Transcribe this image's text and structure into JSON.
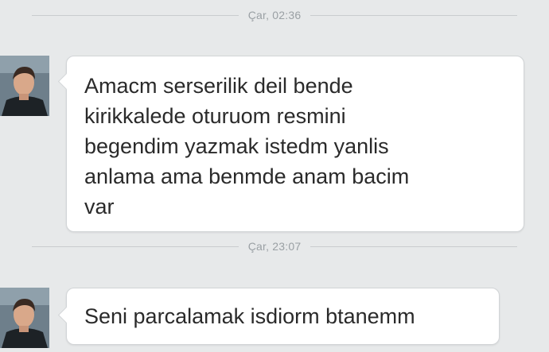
{
  "chat": {
    "dividers": [
      {
        "timestamp": "Çar, 02:36"
      },
      {
        "timestamp": "Çar, 23:07"
      }
    ],
    "messages": [
      {
        "text": "Amacm serserilik deil bende\nkirikkalede oturuom resmini\nbegendim yazmak istedm yanlis\nanlama ama benmde anam bacim\nvar"
      },
      {
        "text": "Seni parcalamak isdiorm btanemm"
      }
    ]
  },
  "colors": {
    "background": "#e7e9ea",
    "bubble": "#ffffff",
    "text": "#2a2a2a",
    "timestamp": "#9aa0a4"
  }
}
